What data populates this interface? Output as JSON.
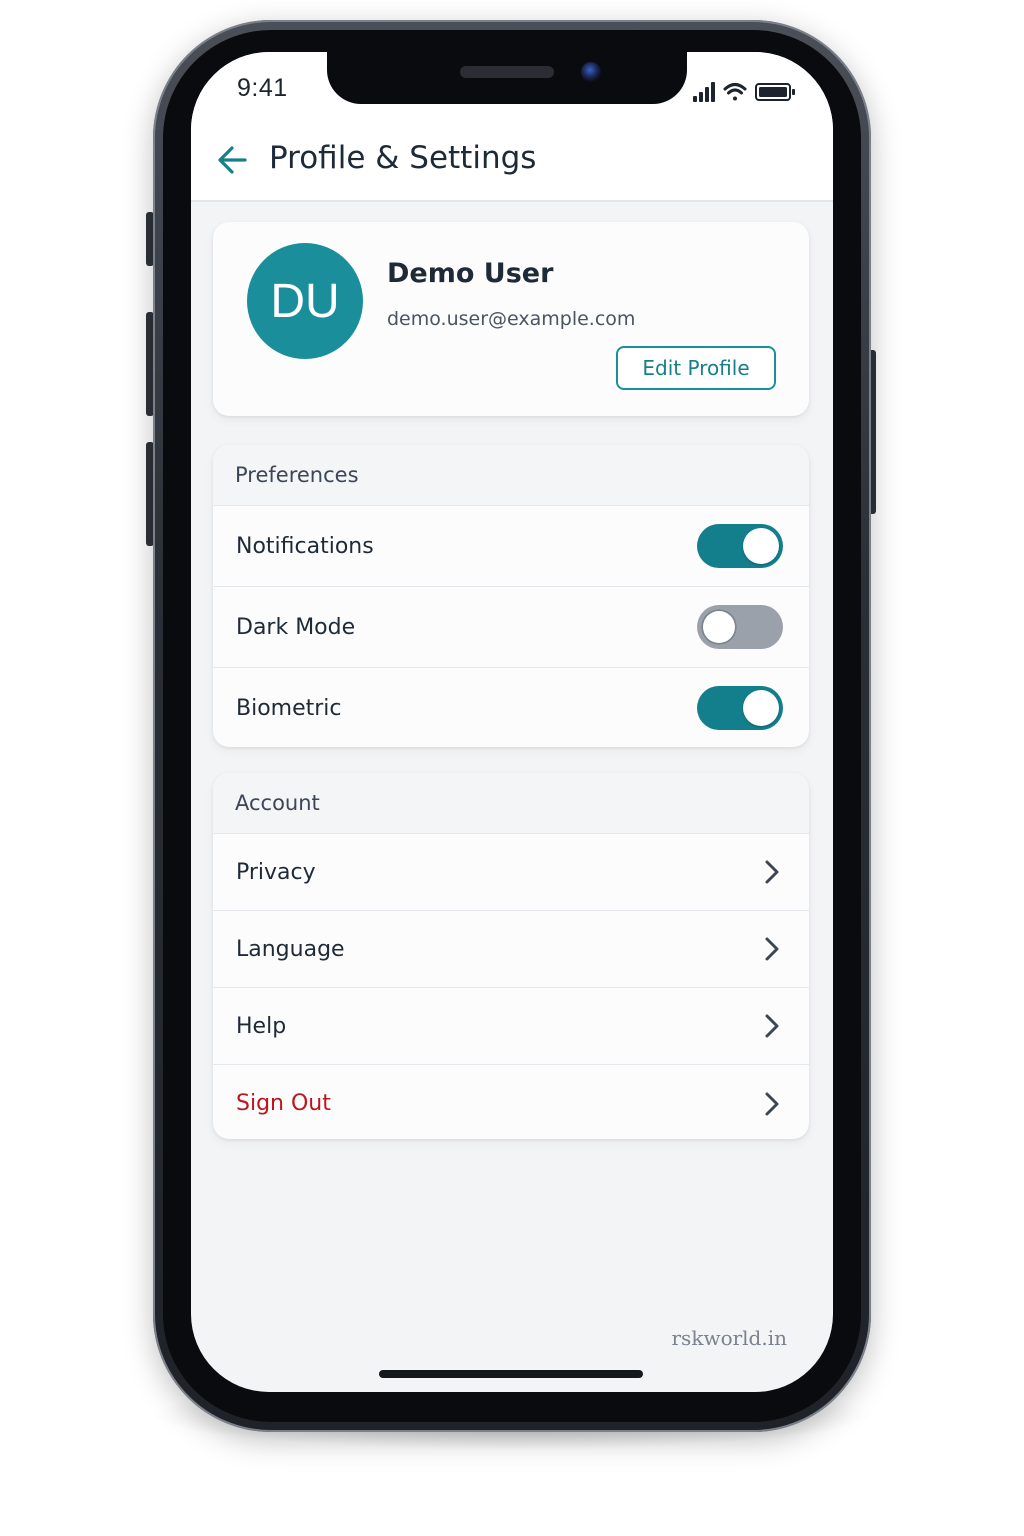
{
  "status_bar": {
    "time": "9:41"
  },
  "header": {
    "title": "Profile & Settings",
    "back_icon": "arrow-left-icon"
  },
  "profile": {
    "initials": "DU",
    "name": "Demo User",
    "email": "demo.user@example.com",
    "edit_label": "Edit Profile"
  },
  "preferences": {
    "heading": "Preferences",
    "items": [
      {
        "label": "Notifications",
        "enabled": true
      },
      {
        "label": "Dark Mode",
        "enabled": false
      },
      {
        "label": "Biometric",
        "enabled": true
      }
    ]
  },
  "account": {
    "heading": "Account",
    "items": [
      {
        "label": "Privacy"
      },
      {
        "label": "Language"
      },
      {
        "label": "Help"
      },
      {
        "label": "Sign Out"
      }
    ]
  },
  "watermark": "rskworld.in",
  "colors": {
    "accent": "#1a8f9b",
    "danger": "#c0141c",
    "toggle_off": "#9aa1ab"
  }
}
